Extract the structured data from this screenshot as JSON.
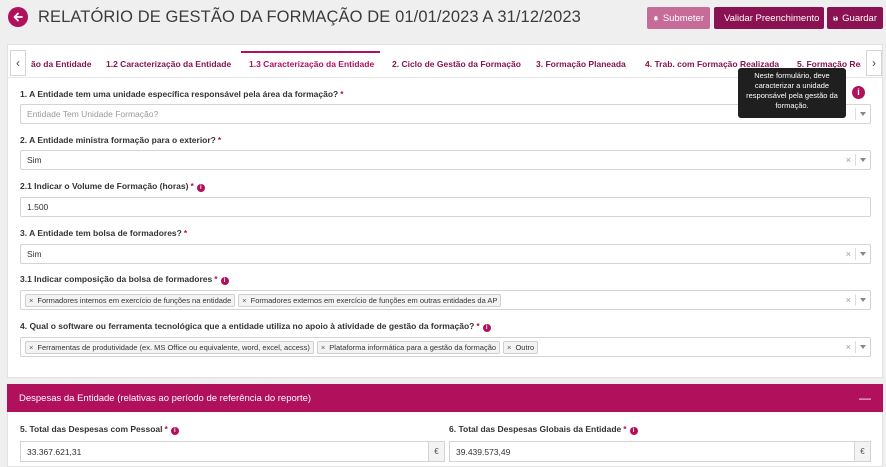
{
  "header": {
    "title": "RELATÓRIO DE GESTÃO DA FORMAÇÃO DE 01/01/2023 A 31/12/2023",
    "submit_label": "Submeter",
    "validate_label": "Validar Preenchimento",
    "save_label": "Guardar"
  },
  "tabs": [
    {
      "label": "ão da Entidade"
    },
    {
      "label": "1.2 Caracterização da Entidade"
    },
    {
      "label": "1.3 Caracterização da Entidade"
    },
    {
      "label": "2. Ciclo de Gestão da Formação"
    },
    {
      "label": "3. Formação Planeada"
    },
    {
      "label": "4. Trab. com Formação Realizada"
    },
    {
      "label": "5. Formação Reali"
    }
  ],
  "tooltip": {
    "text": "Neste formulário, deve caracterizar a unidade responsável pela gestão da formação."
  },
  "form": {
    "q1": {
      "label": "1. A Entidade tem uma unidade específica responsável pela área da formação?",
      "required": "*",
      "placeholder": "Entidade Tem Unidade Formação?"
    },
    "q2": {
      "label": "2. A Entidade ministra formação para o exterior?",
      "required": "*",
      "value": "Sim",
      "clear": "×"
    },
    "q21": {
      "label": "2.1 Indicar o Volume de Formação (horas)",
      "required": "*",
      "value": "1.500"
    },
    "q3": {
      "label": "3. A Entidade tem bolsa de formadores?",
      "required": "*",
      "value": "Sim",
      "clear": "×"
    },
    "q31": {
      "label": "3.1 Indicar composição da bolsa de formadores",
      "required": "*",
      "chips": [
        "Formadores internos em exercício de funções na entidade",
        "Formadores externos em exercício de funções em outras entidades da AP"
      ],
      "clear": "×"
    },
    "q4": {
      "label": "4. Qual o software ou ferramenta tecnológica que a entidade utiliza no apoio à atividade de gestão da formação?",
      "required": "*",
      "chips": [
        "Ferramentas de produtividade (ex. MS Office ou equivalente, word, excel, access)",
        "Plataforma informática para a gestão da formação",
        "Outro"
      ],
      "clear": "×"
    }
  },
  "despesas": {
    "title": "Despesas da Entidade (relativas ao período de referência do reporte)",
    "collapse": "—",
    "q5": {
      "label": "5. Total das Despesas com Pessoal",
      "required": "*",
      "value": "33.367.621,31",
      "currency": "€"
    },
    "q6": {
      "label": "6. Total das Despesas Globais da Entidade",
      "required": "*",
      "value": "39.439.573,49",
      "currency": "€"
    }
  },
  "icons": {
    "info": "i",
    "chip_remove": "×"
  },
  "colors": {
    "primary": "#b0105c",
    "primary_dark": "#8a1252",
    "submit": "#c76c98"
  }
}
